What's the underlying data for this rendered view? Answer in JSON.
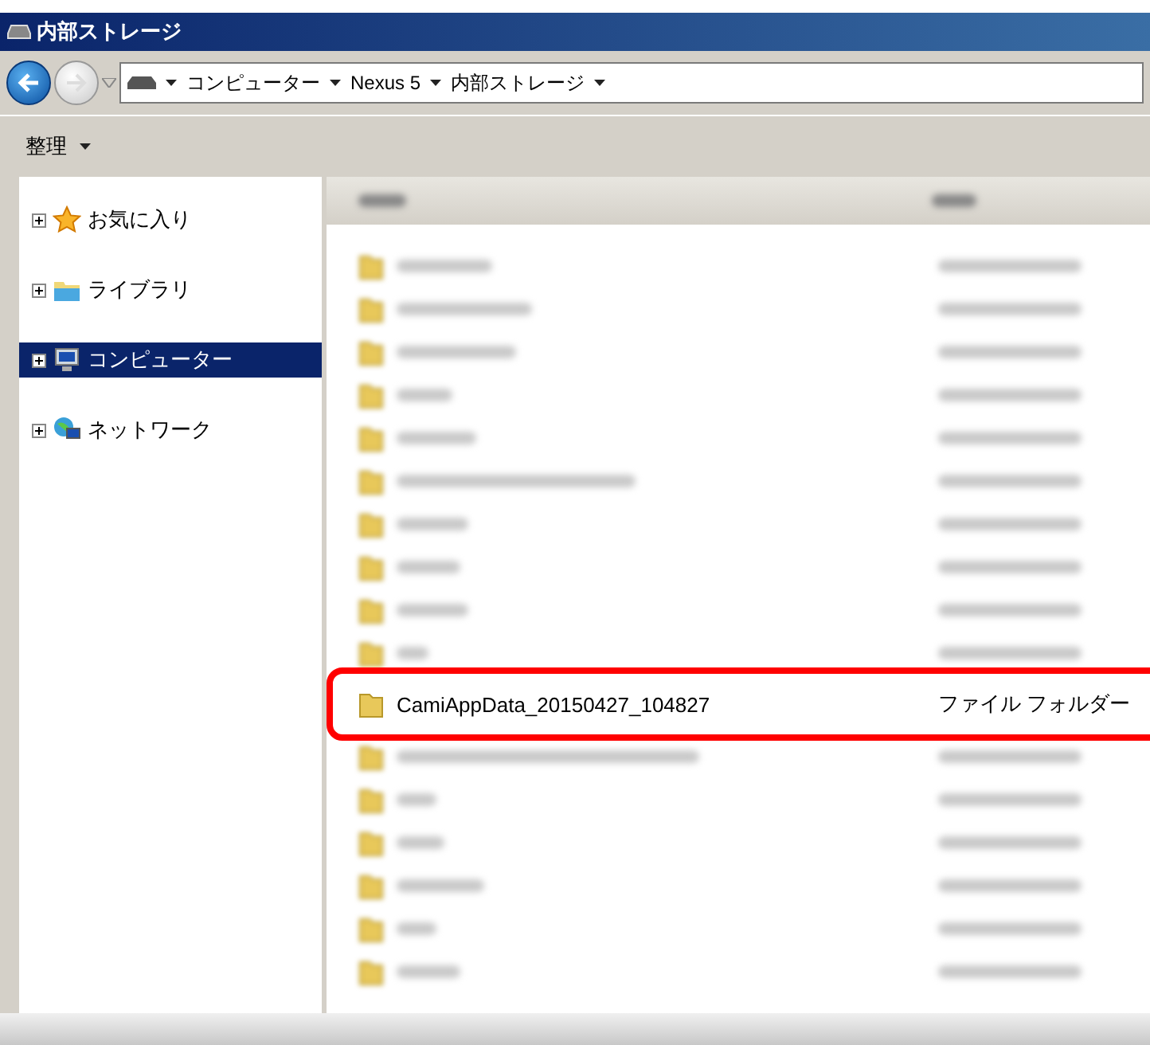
{
  "window": {
    "title": "内部ストレージ"
  },
  "address": {
    "crumbs": [
      "コンピューター",
      "Nexus 5",
      "内部ストレージ"
    ]
  },
  "toolbar": {
    "organize": "整理"
  },
  "sidebar": {
    "items": [
      {
        "kind": "star",
        "label": "お気に入り",
        "selected": false
      },
      {
        "kind": "library",
        "label": "ライブラリ",
        "selected": false
      },
      {
        "kind": "computer",
        "label": "コンピューター",
        "selected": true
      },
      {
        "kind": "network",
        "label": "ネットワーク",
        "selected": false
      }
    ]
  },
  "list": {
    "rows": [
      {
        "kind": "blurred"
      },
      {
        "kind": "blurred"
      },
      {
        "kind": "blurred"
      },
      {
        "kind": "blurred"
      },
      {
        "kind": "blurred"
      },
      {
        "kind": "blurred"
      },
      {
        "kind": "blurred"
      },
      {
        "kind": "blurred"
      },
      {
        "kind": "blurred"
      },
      {
        "kind": "blurred"
      },
      {
        "kind": "file",
        "name": "CamiAppData_20150427_104827",
        "type": "ファイル フォルダー",
        "highlighted": true
      },
      {
        "kind": "blurred"
      },
      {
        "kind": "blurred"
      },
      {
        "kind": "blurred"
      },
      {
        "kind": "blurred"
      },
      {
        "kind": "blurred"
      },
      {
        "kind": "blurred"
      }
    ]
  }
}
